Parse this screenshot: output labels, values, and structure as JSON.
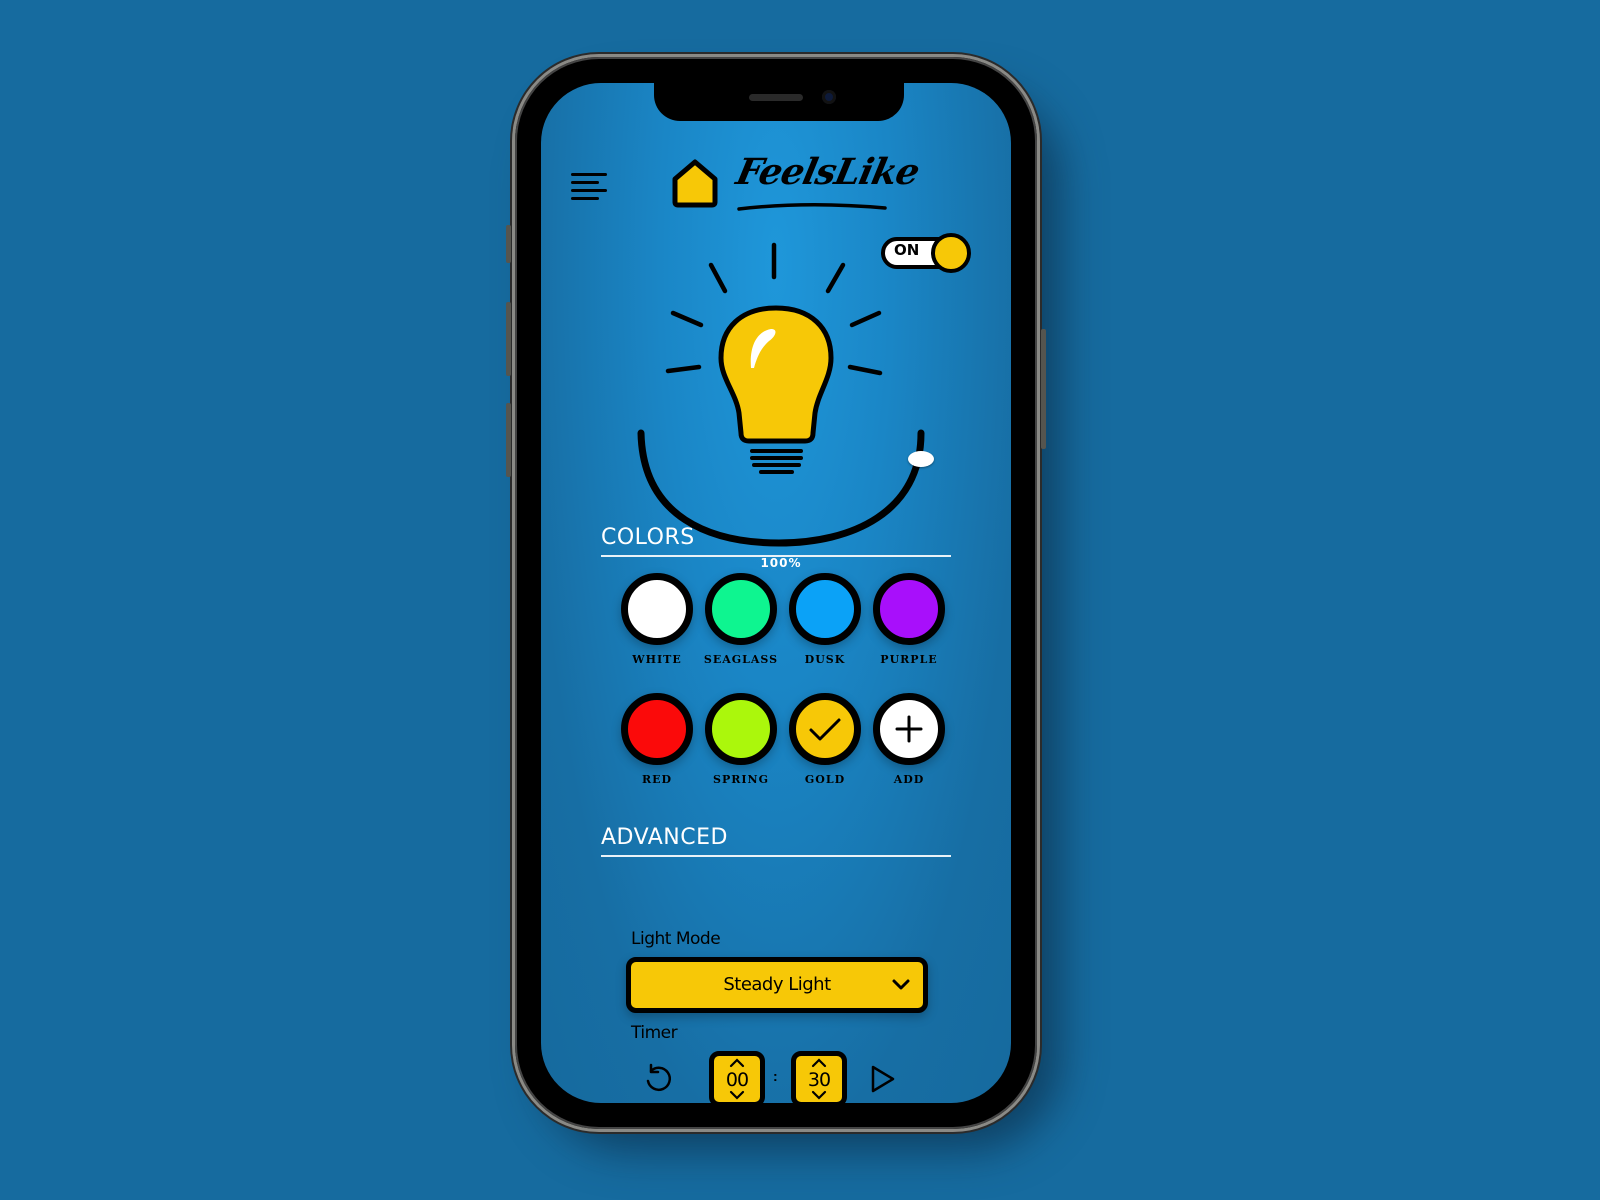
{
  "app": {
    "name": "FeelsLike",
    "power_toggle": {
      "label": "ON",
      "state": true
    },
    "brightness": {
      "value": 1.0,
      "label": "100%"
    }
  },
  "colors_section": {
    "title": "COLORS",
    "swatches": [
      {
        "name": "WHITE",
        "hex": "#ffffff",
        "selected": false
      },
      {
        "name": "SEAGLASS",
        "hex": "#0ef590",
        "selected": false
      },
      {
        "name": "DUSK",
        "hex": "#0ba2f7",
        "selected": false
      },
      {
        "name": "PURPLE",
        "hex": "#a80ffb",
        "selected": false
      },
      {
        "name": "RED",
        "hex": "#fb0a0a",
        "selected": false
      },
      {
        "name": "SPRING",
        "hex": "#abf70c",
        "selected": false
      },
      {
        "name": "GOLD",
        "hex": "#f7c807",
        "selected": true
      },
      {
        "name": "ADD",
        "hex": "#ffffff",
        "selected": false,
        "icon": "plus-icon"
      }
    ]
  },
  "advanced_section": {
    "title": "ADVANCED",
    "light_mode": {
      "label": "Light Mode",
      "value": "Steady Light"
    },
    "timer": {
      "label": "Timer",
      "hours": "00",
      "minutes": "30",
      "separator": ":"
    }
  },
  "theme": {
    "accent": "#f7c807",
    "background": "#166b9f",
    "screen": "#1a86c6"
  }
}
